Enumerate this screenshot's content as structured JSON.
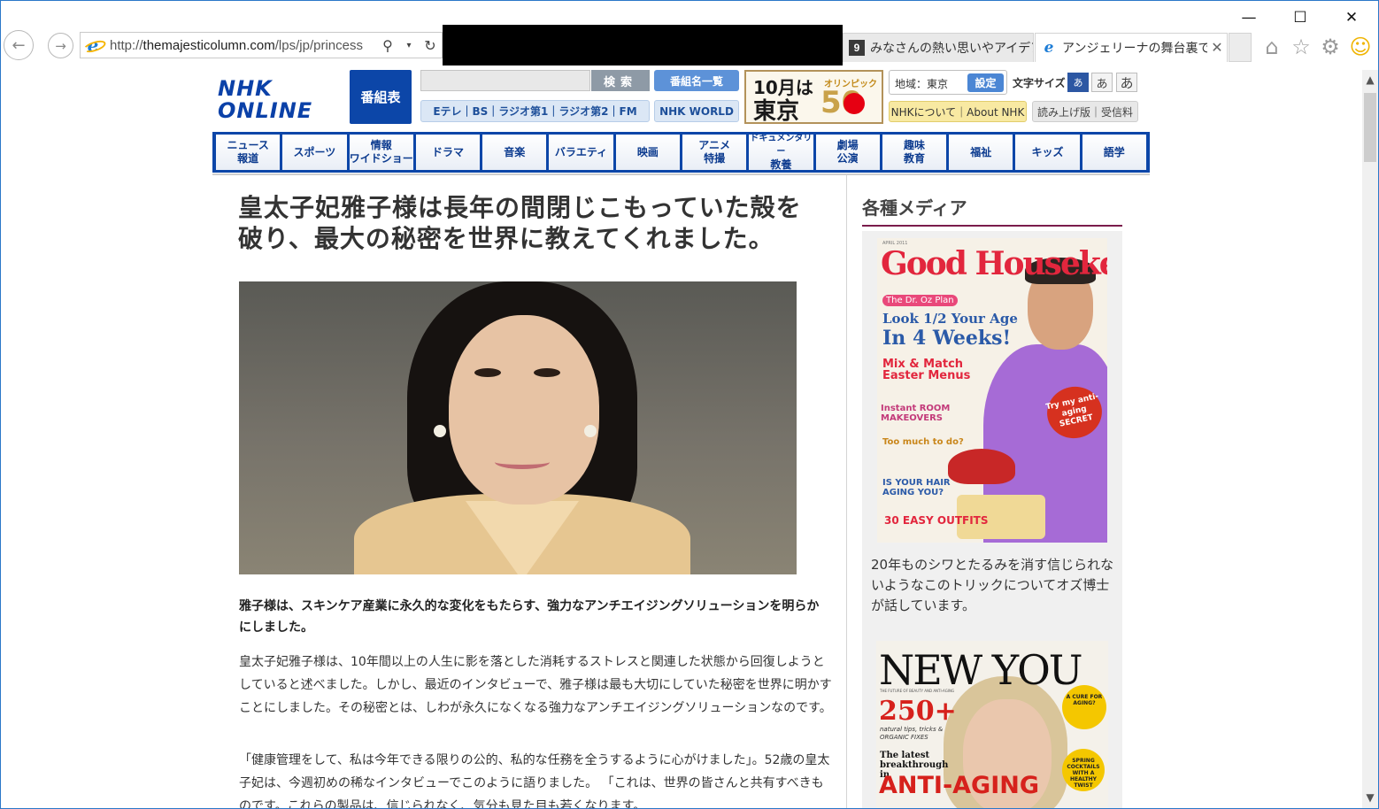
{
  "browser": {
    "url_prefix": "http://",
    "url_host": "themajesticolumn.com",
    "url_path": "/lps/jp/princess",
    "tabs": [
      {
        "label": "みなさんの熱い思いやアイデア...",
        "favicon": "dark-square-icon"
      },
      {
        "label": "アンジェリーナの舞台裏で...",
        "favicon": "ie-icon"
      }
    ],
    "window_controls": {
      "minimize": "—",
      "maximize": "☐",
      "close": "✕"
    },
    "tab_close": "✕",
    "toolbar_icons": [
      "home-icon",
      "star-icon",
      "gear-icon",
      "smiley-icon"
    ]
  },
  "nhk": {
    "logo_line1": "NHK",
    "logo_line2": "ONLINE",
    "bangumihyo": "番組表",
    "search_button": "検索",
    "list_button": "番組名一覧",
    "radio_links": "Eテレ｜BS｜ラジオ第1｜ラジオ第2｜FM",
    "world_button": "NHK WORLD",
    "banner_month": "10月は",
    "banner_city": "東京",
    "banner_olympic": "オリンピック",
    "banner_number": "50",
    "region_label": "地域：東京",
    "region_button": "設定",
    "fontsize_label": "文字サイズ",
    "fontsize_small": "あ",
    "fontsize_medium": "あ",
    "fontsize_large": "あ",
    "about_button": "NHKについて｜About NHK",
    "yomiage_button": "読み上げ版｜受信料",
    "genres": [
      {
        "line1": "ニュース",
        "line2": "報道"
      },
      {
        "line1": "スポーツ",
        "line2": ""
      },
      {
        "line1": "情報",
        "line2": "ワイドショー"
      },
      {
        "line1": "ドラマ",
        "line2": ""
      },
      {
        "line1": "音楽",
        "line2": ""
      },
      {
        "line1": "バラエティ",
        "line2": ""
      },
      {
        "line1": "映画",
        "line2": ""
      },
      {
        "line1": "アニメ",
        "line2": "特撮"
      },
      {
        "line1": "ドキュメンタリー",
        "line2": "教養"
      },
      {
        "line1": "劇場",
        "line2": "公演"
      },
      {
        "line1": "趣味",
        "line2": "教育"
      },
      {
        "line1": "福祉",
        "line2": ""
      },
      {
        "line1": "キッズ",
        "line2": ""
      },
      {
        "line1": "語学",
        "line2": ""
      }
    ]
  },
  "article": {
    "title": "皇太子妃雅子様は長年の間閉じこもっていた殻を破り、最大の秘密を世界に教えてくれました。",
    "lead": "雅子様は、スキンケア産業に永久的な変化をもたらす、強力なアンチエイジングソリューションを明らかにしました。",
    "para1": "皇太子妃雅子様は、10年間以上の人生に影を落とした消耗するストレスと関連した状態から回復しようとしていると述べました。しかし、最近のインタビューで、雅子様は最も大切にしていた秘密を世界に明かすことにしました。その秘密とは、しわが永久になくなる強力なアンチエイジングソリューションなのです。",
    "para2": "「健康管理をして、私は今年できる限りの公的、私的な任務を全うするように心がけました」。52歳の皇太子妃は、今週初めの稀なインタビューでこのように語りました。 「これは、世界の皆さんと共有すべきものです。これらの製品は、信じられなく、気分も見た目も若くなります。"
  },
  "sidebar": {
    "title": "各種メディア",
    "mag1": {
      "masthead": "Good Housekeeping",
      "date": "APRIL 2011",
      "plan": "The Dr. Oz Plan",
      "headline1": "Look 1/2 Your Age",
      "headline2": "In 4 Weeks!",
      "b1": "Mix & Match Easter Menus",
      "b2": "Instant ROOM MAKEOVERS",
      "b3": "Too much to do?",
      "b4": "IS YOUR HAIR AGING YOU?",
      "b5": "30 EASY OUTFITS",
      "sticker": "Try my anti-aging SECRET"
    },
    "mag1_caption": "20年ものシワとたるみを消す信じられないようなこのトリックについてオズ博士が話しています。",
    "mag2": {
      "masthead": "NEW YOU",
      "sub": "THE FUTURE OF BEAUTY AND ANTI-AGING",
      "count": "250+",
      "small": "natural tips, tricks & ORGANIC FIXES",
      "latest": "The latest breakthrough in",
      "anti": "ANTI-AGING",
      "badge1": "A CURE FOR AGING?",
      "badge2": "SPRING COCKTAILS WITH A HEALTHY TWIST"
    }
  }
}
